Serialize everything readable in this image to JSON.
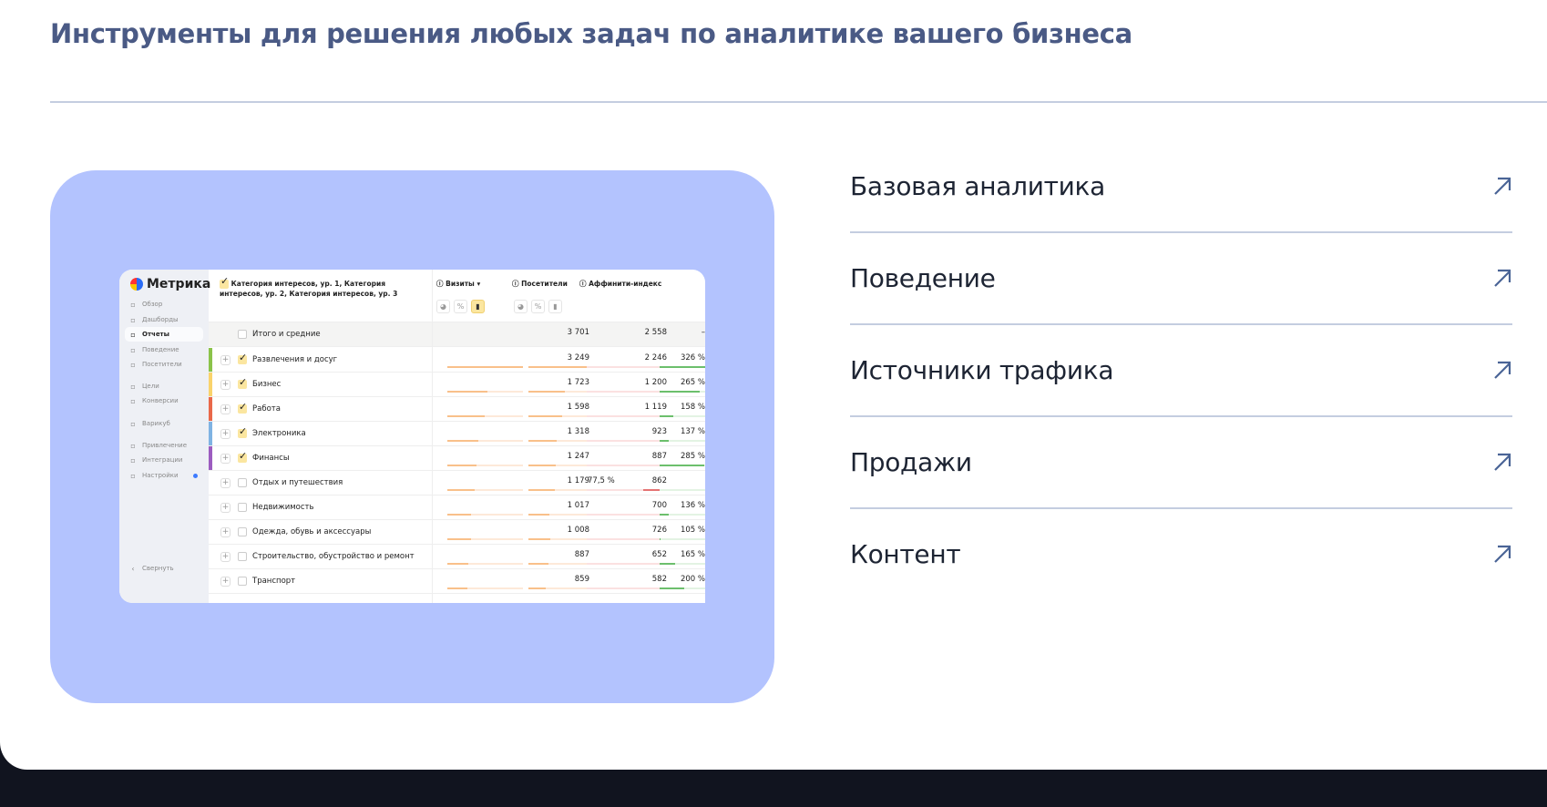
{
  "title": "Инструменты для решения любых задач по аналитике вашего бизнеса",
  "colors": {
    "card": "#b3c3fe",
    "footer": "#11141f",
    "accent": "#4a6496"
  },
  "screenshot": {
    "logo": "Метрика",
    "nav": [
      {
        "label": "Обзор",
        "icon": "grid-icon"
      },
      {
        "label": "Дашборды",
        "icon": "dashboard-icon"
      },
      {
        "label": "Отчеты",
        "icon": "chart-icon",
        "active": true
      },
      {
        "label": "Поведение",
        "icon": "play-icon"
      },
      {
        "label": "Посетители",
        "icon": "user-icon"
      },
      {
        "label": "Цели",
        "icon": "target-icon"
      },
      {
        "label": "Конверсии",
        "icon": "percent-icon"
      },
      {
        "label": "Варикуб",
        "icon": "cube-icon"
      },
      {
        "label": "Привлечение",
        "icon": "fire-icon"
      },
      {
        "label": "Интеграции",
        "icon": "puzzle-icon"
      },
      {
        "label": "Настройки",
        "icon": "gear-icon"
      }
    ],
    "collapse": "Свернуть",
    "group_header": "Категория интересов, ур. 1, Категория интересов, ур. 2, Категория интересов, ур. 3",
    "columns": {
      "visits": "Визиты",
      "sort": "▾",
      "visitors": "Посетители",
      "affinity": "Аффинити-индекс"
    },
    "total": {
      "label": "Итого и средние",
      "visits": "3 701",
      "visitors": "2 558",
      "affinity": "–"
    },
    "rows": [
      {
        "label": "Развлечения и досуг",
        "checked": true,
        "color": "#8bc34a",
        "visits": "3 249",
        "visitors": "2 246",
        "affinity": "326 %",
        "v": 3249,
        "u": 2246,
        "a": 326
      },
      {
        "label": "Бизнес",
        "checked": true,
        "color": "#f9d36b",
        "visits": "1 723",
        "visitors": "1 200",
        "affinity": "265 %",
        "v": 1723,
        "u": 1200,
        "a": 265
      },
      {
        "label": "Работа",
        "checked": true,
        "color": "#e9684a",
        "visits": "1 598",
        "visitors": "1 119",
        "affinity": "158 %",
        "v": 1598,
        "u": 1119,
        "a": 158
      },
      {
        "label": "Электроника",
        "checked": true,
        "color": "#7fb3e3",
        "visits": "1 318",
        "visitors": "923",
        "affinity": "137 %",
        "v": 1318,
        "u": 923,
        "a": 137
      },
      {
        "label": "Финансы",
        "checked": true,
        "color": "#9c5cc0",
        "visits": "1 247",
        "visitors": "887",
        "affinity": "285 %",
        "v": 1247,
        "u": 887,
        "a": 285
      },
      {
        "label": "Отдых и путешествия",
        "checked": false,
        "visits": "1 179",
        "visitors": "862",
        "affinity": "77,5 %",
        "v": 1179,
        "u": 862,
        "a": 77.5
      },
      {
        "label": "Недвижимость",
        "checked": false,
        "visits": "1 017",
        "visitors": "700",
        "affinity": "136 %",
        "v": 1017,
        "u": 700,
        "a": 136
      },
      {
        "label": "Одежда, обувь и аксессуары",
        "checked": false,
        "visits": "1 008",
        "visitors": "726",
        "affinity": "105 %",
        "v": 1008,
        "u": 726,
        "a": 105
      },
      {
        "label": "Строительство, обустройство и ремонт",
        "checked": false,
        "visits": "887",
        "visitors": "652",
        "affinity": "165 %",
        "v": 887,
        "u": 652,
        "a": 165
      },
      {
        "label": "Транспорт",
        "checked": false,
        "visits": "859",
        "visitors": "582",
        "affinity": "200 %",
        "v": 859,
        "u": 582,
        "a": 200
      }
    ]
  },
  "sections": [
    {
      "label": "Базовая аналитика"
    },
    {
      "label": "Поведение"
    },
    {
      "label": "Источники трафика"
    },
    {
      "label": "Продажи"
    },
    {
      "label": "Контент"
    }
  ]
}
